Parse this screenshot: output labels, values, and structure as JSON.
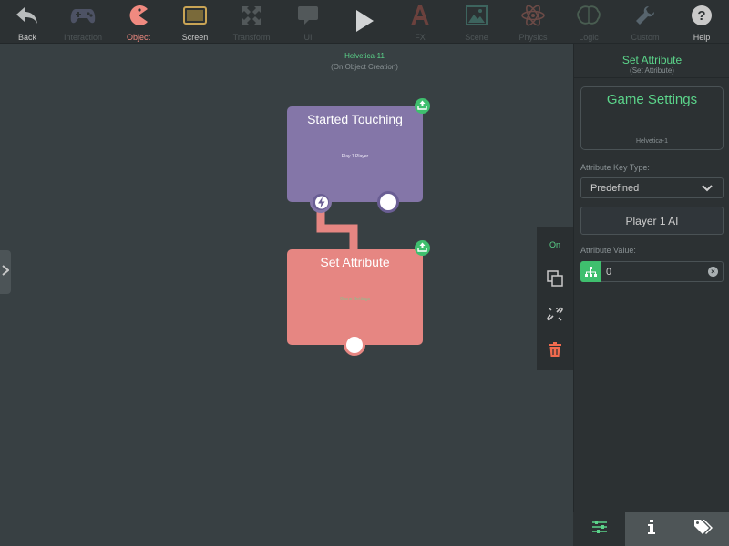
{
  "toolbar": {
    "items": [
      {
        "label": "Back",
        "icon": "back-arrow-icon"
      },
      {
        "label": "Interaction",
        "icon": "gamepad-icon"
      },
      {
        "label": "Object",
        "icon": "pacman-icon"
      },
      {
        "label": "Screen",
        "icon": "screen-icon"
      },
      {
        "label": "Transform",
        "icon": "transform-icon"
      },
      {
        "label": "UI",
        "icon": "speech-bubble-icon"
      },
      {
        "label": "",
        "icon": "play-icon"
      },
      {
        "label": "FX",
        "icon": "fx-icon"
      },
      {
        "label": "Scene",
        "icon": "image-icon"
      },
      {
        "label": "Physics",
        "icon": "atom-icon"
      },
      {
        "label": "Logic",
        "icon": "brain-icon"
      },
      {
        "label": "Custom",
        "icon": "wrench-icon"
      },
      {
        "label": "Help",
        "icon": "help-icon"
      }
    ],
    "selected": "Object"
  },
  "canvas": {
    "trigger_title": "Helvetica-11",
    "trigger_subtitle": "(On Object Creation)"
  },
  "nodes": {
    "trigger": {
      "title": "Started Touching",
      "subtitle": "Play 1 Player",
      "color": "#8476a8"
    },
    "action": {
      "title": "Set Attribute",
      "subtitle": "Game Settings",
      "color": "#e68682"
    }
  },
  "mini_bar": {
    "on_label": "On",
    "icons": [
      "copy-icon",
      "unlink-icon",
      "trash-icon"
    ]
  },
  "panel": {
    "title": "Set Attribute",
    "subtitle": "(Set Attribute)",
    "target_name": "Game Settings",
    "target_font": "Helvetica-1",
    "key_type_label": "Attribute Key Type:",
    "key_type_value": "Predefined",
    "key_button": "Player 1 AI",
    "value_label": "Attribute Value:",
    "value": "0"
  },
  "bottom_tabs": {
    "icons": [
      "sliders-icon",
      "info-icon",
      "tags-icon"
    ]
  },
  "colors": {
    "accent": "#5bd48a",
    "selected_tab": "#f08a80",
    "background": "#384043"
  }
}
